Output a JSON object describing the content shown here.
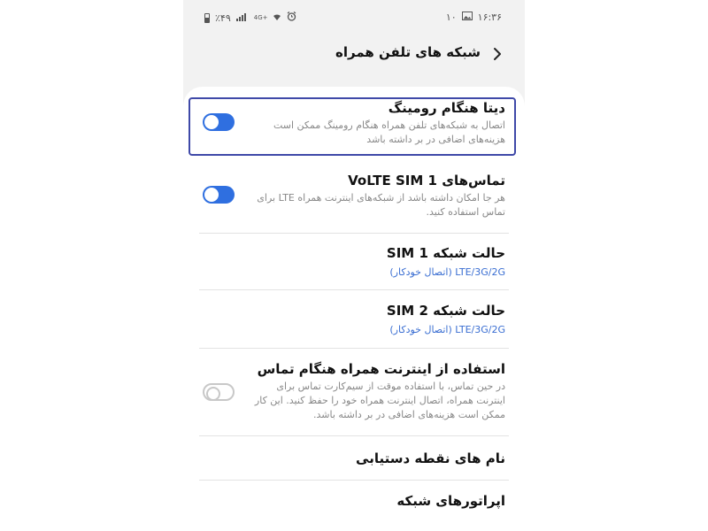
{
  "status_bar": {
    "time": "۱۶:۳۶",
    "notification_count": "۱۰",
    "battery_percent": "٪۴۹",
    "network_type": "4G+",
    "icons": [
      "gallery-icon",
      "alarm-icon",
      "wifi-icon",
      "signal-icon",
      "battery-icon"
    ]
  },
  "header": {
    "title": "شبکه های تلفن همراه",
    "back_icon": "chevron-right-icon"
  },
  "settings": {
    "data_roaming": {
      "title": "دیتا هنگام رومینگ",
      "description": "اتصال به شبکه‌های تلفن همراه هنگام رومینگ ممکن است هزینه‌های اضافی در بر داشته باشد",
      "enabled": true
    },
    "volte": {
      "title": "تماس‌های VoLTE SIM 1",
      "description": "هر جا امکان داشته باشد از شبکه‌های اینترنت همراه LTE برای تماس استفاده کنید.",
      "enabled": true
    },
    "sim1_mode": {
      "title": "حالت شبکه SIM 1",
      "value": "LTE/3G/2G (اتصال خودکار)"
    },
    "sim2_mode": {
      "title": "حالت شبکه SIM 2",
      "value": "LTE/3G/2G (اتصال خودکار)"
    },
    "data_during_calls": {
      "title": "استفاده از اینترنت همراه هنگام تماس",
      "description": "در حین تماس، با استفاده موقت از سیم‌کارت تماس برای اینترنت همراه، اتصال اینترنت همراه خود را حفظ کنید. این کار ممکن است هزینه‌های اضافی در بر داشته باشد.",
      "enabled": false
    },
    "access_point_names": {
      "title": "نام های نقطه دستیابی"
    },
    "network_operators": {
      "title": "اپراتورهای شبکه"
    }
  },
  "colors": {
    "accent": "#2f6fe0",
    "link": "#3a6ed2",
    "focus": "#3f49a8",
    "background": "#f2f2f2"
  }
}
